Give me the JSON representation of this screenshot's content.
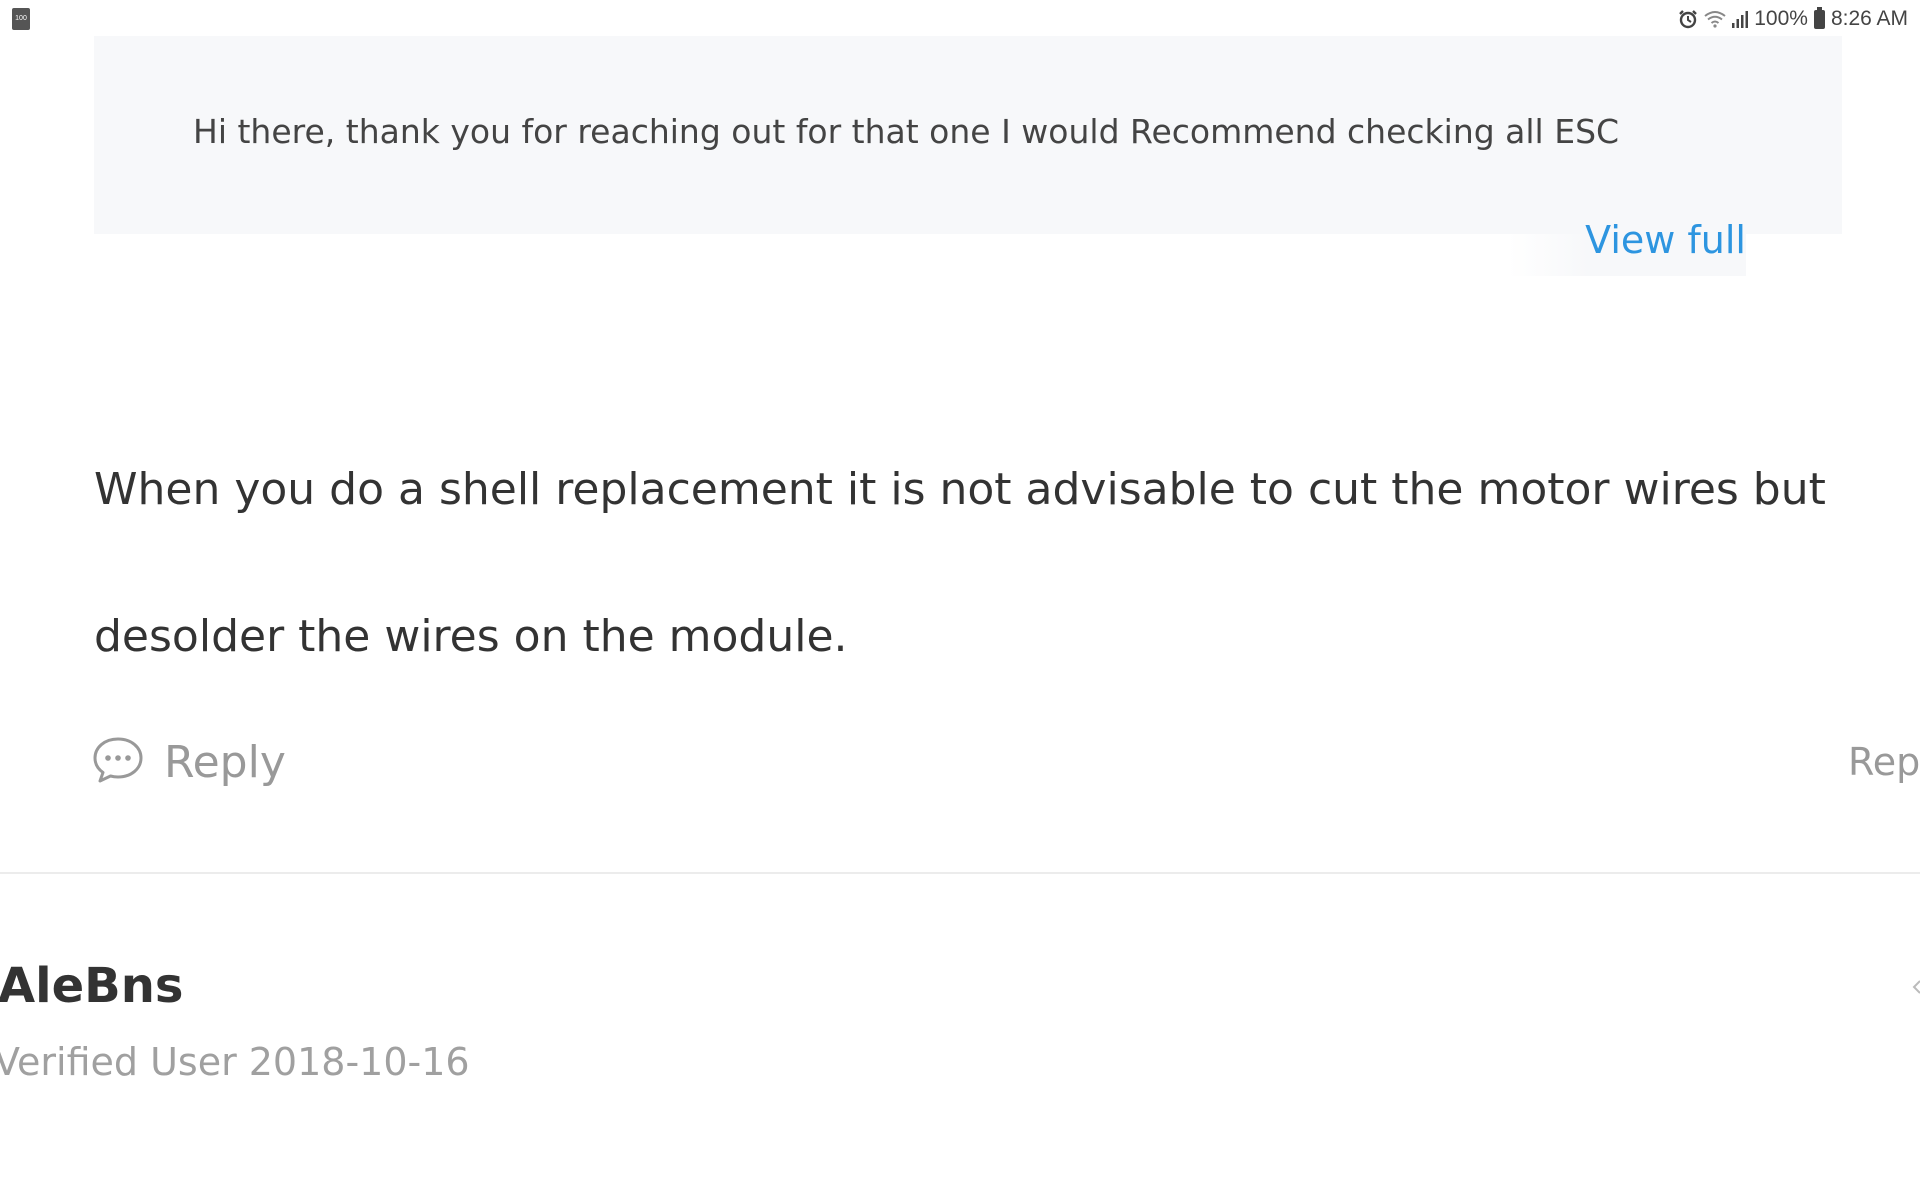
{
  "status_bar": {
    "left_icon": "100",
    "right": {
      "alarm_icon": "alarm-icon",
      "wifi_icon": "wifi-icon",
      "signal_icon": "signal-icon",
      "battery_percent": "100%",
      "battery_icon": "battery-icon",
      "time": "8:26 AM"
    }
  },
  "seller_reply": {
    "text": "Hi there, thank you for reaching out for that one I would Recommend checking all ESC",
    "view_full_label": "View full"
  },
  "review": {
    "text": "When you do a shell replacement it is not advisable to cut the motor wires but desolder the wires on the module."
  },
  "actions": {
    "reply_label": "Reply",
    "reply_icon": "chat-bubble-icon",
    "report_label": "Report"
  },
  "next_review": {
    "username": "AleBns",
    "badge": "Verified User",
    "date": "2018-10-16"
  },
  "colors": {
    "link": "#2d95e0",
    "muted": "#999999",
    "reply_box_bg": "#f7f8fa",
    "text": "#333333"
  }
}
